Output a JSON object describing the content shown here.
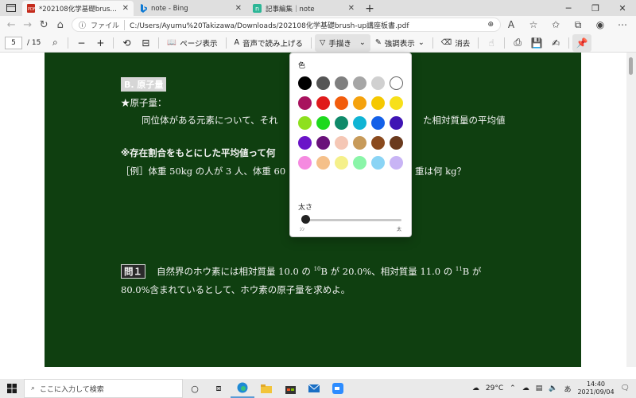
{
  "browser": {
    "tabs": [
      {
        "title": "*202108化学基礎brush-up講座板書.pdf",
        "icon": "pdf-icon",
        "active": true
      },
      {
        "title": "note - Bing",
        "icon": "bing-icon",
        "active": false
      },
      {
        "title": "記事編集｜note",
        "icon": "note-icon",
        "active": false
      }
    ],
    "address": {
      "scheme": "ファイル",
      "url": "C:/Users/Ayumu%20Takizawa/Downloads/202108化学基礎brush-up講座板書.pdf"
    }
  },
  "pdf_toolbar": {
    "current_page": "5",
    "total_pages": "/ 15",
    "page_view_label": "ページ表示",
    "read_aloud_label": "音声で読み上げる",
    "draw_label": "手描き",
    "highlight_label": "強調表示",
    "erase_label": "消去"
  },
  "document": {
    "heading": "B. 原子量",
    "line1": "★原子量：",
    "line2_left": "同位体がある元素について、それ",
    "line2_right": "た相対質量の平均値",
    "line3": "※存在割合をもとにした平均値って何",
    "line4_left": "［例］体重 50kg の人が 3 人、体重 60",
    "line4_right": "重は何 kg？",
    "q_label": "問１",
    "q_text_a": "自然界のホウ素には相対質量 10.0 の ",
    "q_sup1": "10",
    "q_text_b": "B が 20.0%、相対質量 11.0 の ",
    "q_sup2": "11",
    "q_text_c": "B が",
    "q_line2": "80.0%含まれているとして、ホウ素の原子量を求めよ。"
  },
  "pen_panel": {
    "color_label": "色",
    "size_label": "太さ",
    "size_min": "ｼﾝ",
    "size_max": "太",
    "size_value": 0.0,
    "colors": [
      "#000000",
      "#555555",
      "#7f7f7f",
      "#a6a6a6",
      "#d0d0d0",
      "#ffffff",
      "#a8125e",
      "#e01b1b",
      "#f25c0c",
      "#f5a20d",
      "#f5c800",
      "#f7e01a",
      "#8ee01e",
      "#1ed91e",
      "#0f8a6a",
      "#10b4d4",
      "#1460e8",
      "#3f14b4",
      "#6a14c8",
      "#6a127a",
      "#f5c7b5",
      "#c79a5a",
      "#8a4a1e",
      "#6a3a1e",
      "#f58ae0",
      "#f5c08a",
      "#f5f08a",
      "#8af5a8",
      "#8ad4f5",
      "#c8b4f5"
    ]
  },
  "taskbar": {
    "search_placeholder": "ここに入力して検索",
    "temperature": "29°C",
    "ime": "あ",
    "time": "14:40",
    "date": "2021/09/04"
  }
}
